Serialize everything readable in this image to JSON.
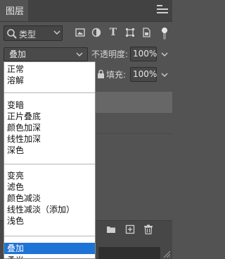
{
  "panel": {
    "title": "图层"
  },
  "filter": {
    "kind_label": "类型"
  },
  "blend": {
    "current": "叠加"
  },
  "opacity": {
    "label": "不透明度:",
    "value": "100%"
  },
  "fill": {
    "label": "填充:",
    "value": "100%"
  },
  "blend_menu": {
    "groups": [
      [
        "正常",
        "溶解"
      ],
      [
        "变暗",
        "正片叠底",
        "颜色加深",
        "线性加深",
        "深色"
      ],
      [
        "变亮",
        "滤色",
        "颜色减淡",
        "线性减淡（添加）",
        "浅色"
      ],
      [
        "叠加",
        "柔光"
      ]
    ],
    "selected": "叠加"
  },
  "colors": {
    "panel_bg": "#535353",
    "menu_selection": "#1e73d6"
  }
}
